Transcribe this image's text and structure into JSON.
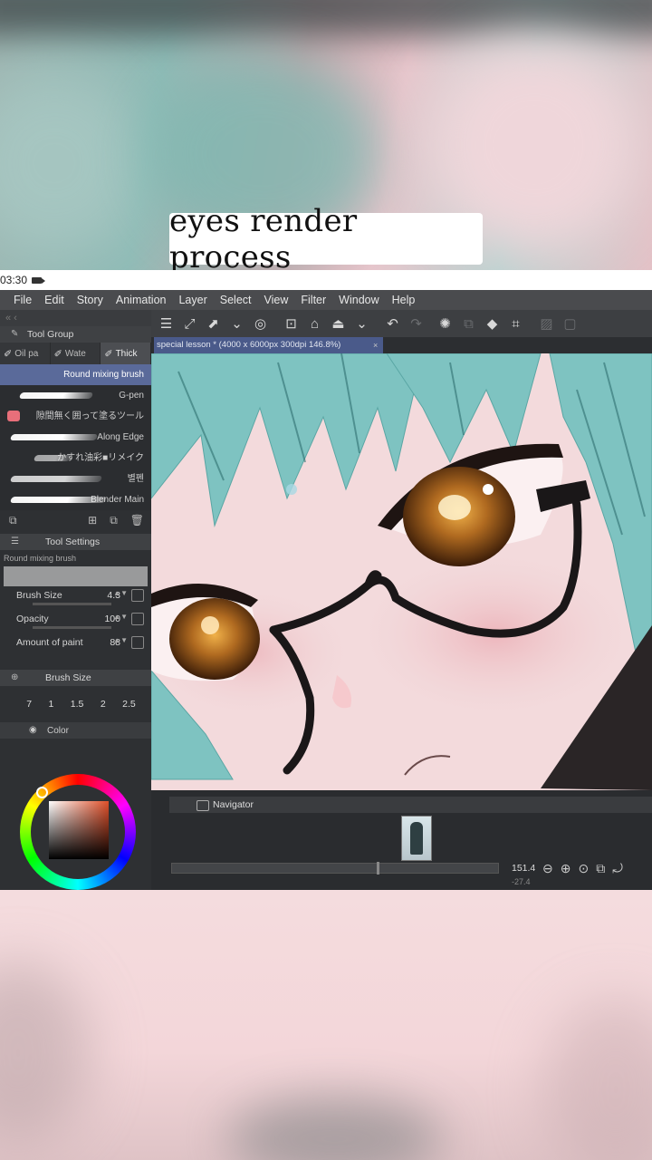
{
  "caption": "eyes render process",
  "status": {
    "time": "03:30"
  },
  "menu": [
    "File",
    "Edit",
    "Story",
    "Animation",
    "Layer",
    "Select",
    "View",
    "Filter",
    "Window",
    "Help"
  ],
  "tool_group": {
    "title": "Tool Group",
    "tabs": [
      "Oil pa",
      "Wate",
      "Thick"
    ],
    "brushes": [
      "Round mixing brush",
      "G-pen",
      "隙間無く囲って塗るツール",
      "Along Edge",
      "かすれ油彩■リメイク",
      "별펜",
      "Blender Main"
    ]
  },
  "tool_settings": {
    "title": "Tool Settings",
    "brush_name": "Round mixing brush",
    "brush_size_label": "Brush Size",
    "brush_size_value": "4.3",
    "opacity_label": "Opacity",
    "opacity_value": "100",
    "amount_label": "Amount of paint",
    "amount_value": "88"
  },
  "brush_size_panel": {
    "title": "Brush Size",
    "sizes": [
      "7",
      "1",
      "1.5",
      "2",
      "2.5"
    ]
  },
  "color_panel": {
    "title": "Color",
    "accent": "#e0502a"
  },
  "document": {
    "tab_title": "special lesson * (4000 x 6000px 300dpi 146.8%)",
    "close": "×"
  },
  "navigator": {
    "title": "Navigator",
    "zoom": "151.4",
    "rotate": "-27.4"
  },
  "icons": [
    "hamburger-icon",
    "fit-icon",
    "transform-icon",
    "chevron-down-icon",
    "record-icon",
    "new-icon",
    "open-icon",
    "save-icon",
    "undo-icon",
    "redo-icon",
    "loading-icon",
    "layer-icon",
    "fill-icon",
    "crop-icon"
  ]
}
